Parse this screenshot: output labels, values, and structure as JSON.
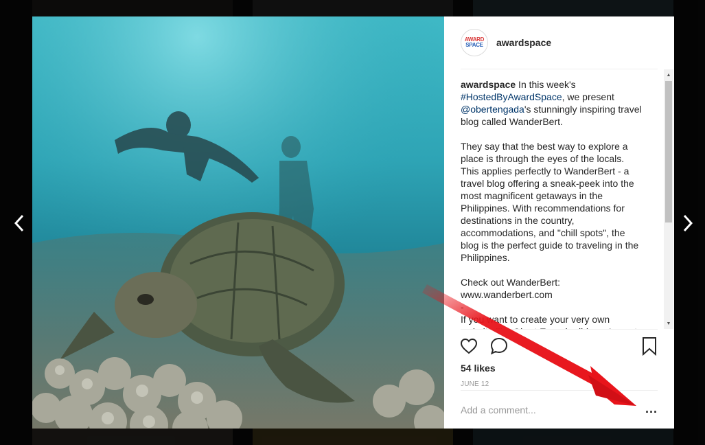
{
  "post": {
    "username": "awardspace",
    "avatar": {
      "line1": "AWARD",
      "line2": "SPACE"
    },
    "caption": {
      "author": "awardspace",
      "intro": " In this week's ",
      "hashtag": "#HostedByAwardSpace",
      "mid1": ", we present ",
      "mention": "@obertengada",
      "body": "'s stunningly inspiring travel blog called WanderBert.\n\nThey say that the best way to explore a place is through the eyes of the locals. This applies perfectly to WanderBert - a travel blog offering a sneak-peek into the most magnificent getaways in the Philippines. With recommendations for destinations in the country, accommodations, and \"chill spots\", the blog is the perfect guide to traveling in the Philippines.\n\nCheck out WanderBert:\nwww.wanderbert.com\n-\nIf you want to create your very own website like Obert Engada did, you've got our personality and support, which is the kind"
    },
    "likes": "54 likes",
    "date": "June 12",
    "comment_placeholder": "Add a comment...",
    "more_label": "..."
  },
  "colors": {
    "annotation_arrow": "#e8141b",
    "link": "#003569",
    "muted": "#999999"
  },
  "icons": {
    "like": "heart-icon",
    "comment": "speech-bubble-icon",
    "save": "bookmark-icon",
    "prev": "chevron-left-icon",
    "next": "chevron-right-icon"
  }
}
